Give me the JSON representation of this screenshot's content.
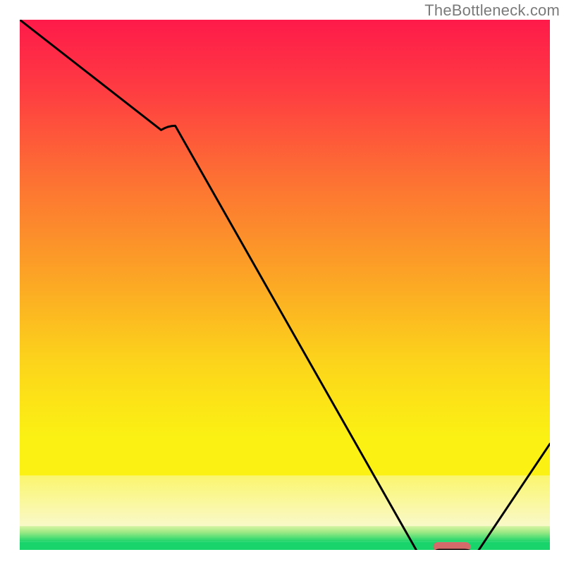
{
  "attribution": "TheBottleneck.com",
  "chart_data": {
    "type": "line",
    "title": "",
    "xlabel": "",
    "ylabel": "",
    "xlim": [
      0,
      100
    ],
    "ylim": [
      0,
      100
    ],
    "x": [
      0,
      28,
      78,
      85,
      100
    ],
    "bottleneck": [
      100,
      80,
      0,
      0,
      20
    ],
    "bands": {
      "top_gradient_top": 100,
      "top_gradient_bottom": 14,
      "pale_band_top": 14,
      "pale_band_bottom": 4.5,
      "green_band_top": 4.5,
      "green_band_bottom": 1.5,
      "solid_green_top": 1.5,
      "solid_green_bottom": 0
    },
    "marker": {
      "x_start": 78,
      "x_end": 85,
      "y": 0.6
    },
    "colors": {
      "line": "#000000",
      "marker": "#d46a6a",
      "solid_green": "#18d46a"
    }
  }
}
